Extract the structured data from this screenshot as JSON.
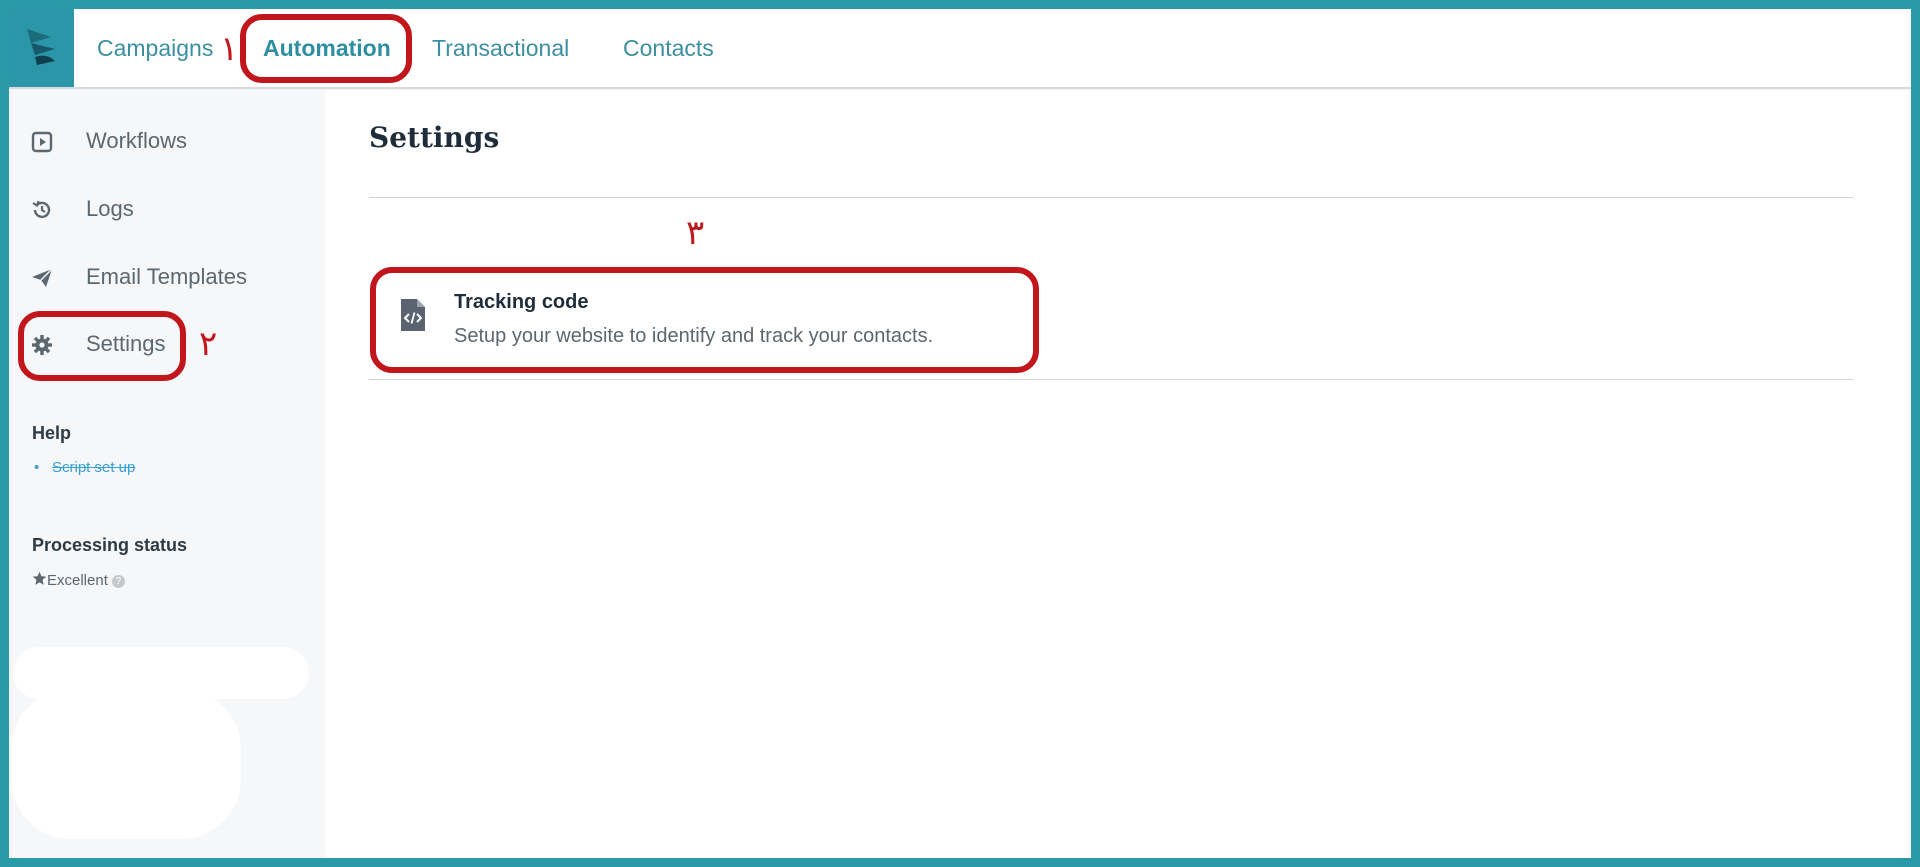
{
  "topnav": {
    "items": [
      {
        "label": "Campaigns"
      },
      {
        "label": "Automation"
      },
      {
        "label": "Transactional"
      },
      {
        "label": "Contacts"
      }
    ]
  },
  "sidebar": {
    "items": [
      {
        "label": "Workflows",
        "icon": "play-square-icon"
      },
      {
        "label": "Logs",
        "icon": "history-icon"
      },
      {
        "label": "Email Templates",
        "icon": "paper-plane-icon"
      },
      {
        "label": "Settings",
        "icon": "gear-icon"
      }
    ],
    "help": {
      "title": "Help",
      "link": "Script set up"
    },
    "processing": {
      "title": "Processing status",
      "status": "Excellent"
    }
  },
  "main": {
    "title": "Settings",
    "settings": [
      {
        "title": "Tracking code",
        "description": "Setup your website to identify and track your contacts.",
        "icon": "code-file-icon"
      }
    ]
  },
  "annotations": [
    "١",
    "٢",
    "٣"
  ],
  "colors": {
    "accent": "#2b96a8",
    "annotation": "#c0161c",
    "link": "#3aa0d5"
  }
}
